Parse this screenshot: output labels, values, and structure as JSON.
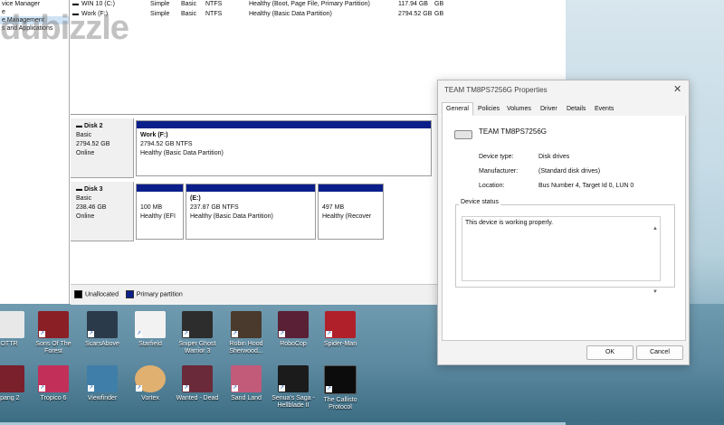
{
  "left_nav": [
    "vice Manager",
    "e",
    "e Management",
    "s and Applications"
  ],
  "volumes": [
    {
      "name": "WIN 10 (C:)",
      "layout": "Simple",
      "type": "Basic",
      "fs": "NTFS",
      "status": "Healthy (Boot, Page File, Primary Partition)",
      "capacity": "117.94 GB",
      "free": "GB"
    },
    {
      "name": "Work (F:)",
      "layout": "Simple",
      "type": "Basic",
      "fs": "NTFS",
      "status": "Healthy (Basic Data Partition)",
      "capacity": "2794.52 GB",
      "free": "GB"
    }
  ],
  "disks": [
    {
      "label": "Disk 2",
      "type": "Basic",
      "size": "2794.52 GB",
      "state": "Online",
      "partitions": [
        {
          "line1": "Work  (F:)",
          "line2": "2794.52 GB NTFS",
          "line3": "Healthy (Basic Data Partition)"
        }
      ]
    },
    {
      "label": "Disk 3",
      "type": "Basic",
      "size": "238.46 GB",
      "state": "Online",
      "partitions": [
        {
          "line1": "",
          "line2": "100 MB",
          "line3": "Healthy (EFI"
        },
        {
          "line1": "(E:)",
          "line2": "237.87 GB NTFS",
          "line3": "Healthy (Basic Data Partition)"
        },
        {
          "line1": "",
          "line2": "497 MB",
          "line3": "Healthy (Recover"
        }
      ]
    }
  ],
  "legend": {
    "unallocated": "Unallocated",
    "primary": "Primary partition"
  },
  "colors": {
    "primary_partition": "#0b1f8a",
    "unallocated": "#000000"
  },
  "watermark": "dubizzle",
  "dialog": {
    "title": "TEAM TM8PS7256G Properties",
    "close": "✕",
    "tabs": [
      "General",
      "Policies",
      "Volumes",
      "Driver",
      "Details",
      "Events"
    ],
    "active_tab": "General",
    "device_name": "TEAM TM8PS7256G",
    "props": [
      {
        "k": "Device type:",
        "v": "Disk drives"
      },
      {
        "k": "Manufacturer:",
        "v": "(Standard disk drives)"
      },
      {
        "k": "Location:",
        "v": "Bus Number 4, Target Id 0, LUN 0"
      }
    ],
    "status_title": "Device status",
    "status_text": "This device is working properly.",
    "ok": "OK",
    "cancel": "Cancel"
  },
  "desktop_icons_row1": [
    "OTTR",
    "Sons Of The Forest",
    "ScarsAbove",
    "Starfield",
    "Sniper Ghost Warrior 3",
    "Robin Hood Sherwood...",
    "RoboCop",
    "Spider-Man"
  ],
  "desktop_icons_row2": [
    "ipang 2",
    "Tropico 6",
    "Viewfinder",
    "Vortex",
    "Wanted - Dead",
    "Sand Land",
    "Senua's Saga - Hellblade II",
    "The Callisto Protocol"
  ]
}
